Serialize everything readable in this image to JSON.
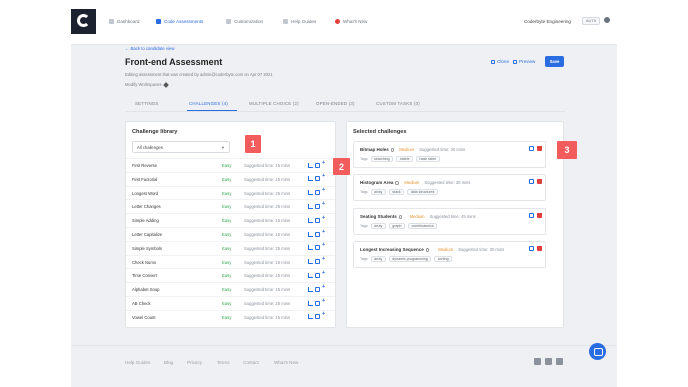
{
  "nav": {
    "items": [
      {
        "label": "Dashboard",
        "active": false
      },
      {
        "label": "Code Assessments",
        "active": true
      },
      {
        "label": "Customization",
        "active": false
      },
      {
        "label": "Help Guides",
        "active": false
      },
      {
        "label": "What's New",
        "active": false
      }
    ],
    "org_name": "Coderbyte Engineering",
    "auto_badge": "AUTH"
  },
  "header": {
    "back_link": "← Back to candidate view",
    "title": "Front-end Assessment",
    "subtitle": "Editing assessment that was created by admin@coderbyte.com on Apr 07 2021",
    "modify": "Modify Workspaces",
    "clone_label": "Clone",
    "preview_label": "Preview",
    "save_label": "Save"
  },
  "tabs": [
    {
      "label": "SETTINGS",
      "active": false
    },
    {
      "label": "CHALLENGES (4)",
      "active": true
    },
    {
      "label": "MULTIPLE CHOICE (2)",
      "active": false
    },
    {
      "label": "OPEN-ENDED (3)",
      "active": false
    },
    {
      "label": "CUSTOM TASKS (0)",
      "active": false
    }
  ],
  "library": {
    "title": "Challenge library",
    "filter_value": "All challenges",
    "challenges": [
      {
        "name": "First Reverse",
        "difficulty": "Easy",
        "time": "Suggested time: 15 mins"
      },
      {
        "name": "First Factorial",
        "difficulty": "Easy",
        "time": "Suggested time: 15 mins"
      },
      {
        "name": "Longest Word",
        "difficulty": "Easy",
        "time": "Suggested time: 25 mins"
      },
      {
        "name": "Letter Changes",
        "difficulty": "Easy",
        "time": "Suggested time: 25 mins"
      },
      {
        "name": "Simple Adding",
        "difficulty": "Easy",
        "time": "Suggested time: 15 mins"
      },
      {
        "name": "Letter Capitalize",
        "difficulty": "Easy",
        "time": "Suggested time: 15 mins"
      },
      {
        "name": "Simple Symbols",
        "difficulty": "Easy",
        "time": "Suggested time: 25 mins"
      },
      {
        "name": "Check Nums",
        "difficulty": "Easy",
        "time": "Suggested time: 15 mins"
      },
      {
        "name": "Time Convert",
        "difficulty": "Easy",
        "time": "Suggested time: 15 mins"
      },
      {
        "name": "Alphabet Soup",
        "difficulty": "Easy",
        "time": "Suggested time: 15 mins"
      },
      {
        "name": "AB Check",
        "difficulty": "Easy",
        "time": "Suggested time: 25 mins"
      },
      {
        "name": "Vowel Count",
        "difficulty": "Easy",
        "time": "Suggested time: 15 mins"
      }
    ]
  },
  "selected": {
    "title": "Selected challenges",
    "items": [
      {
        "name": "Bitmap Holes",
        "difficulty": "Medium",
        "time": "Suggested time: 30 mins",
        "tags_label": "Tags",
        "tags": [
          "searching",
          "matrix",
          "hash table"
        ]
      },
      {
        "name": "Histogram Area",
        "difficulty": "Medium",
        "time": "Suggested time: 30 mins",
        "tags_label": "Tags",
        "tags": [
          "array",
          "stack",
          "data structures"
        ]
      },
      {
        "name": "Seating Students",
        "difficulty": "Medium",
        "time": "Suggested time: 45 mins",
        "tags_label": "Tags",
        "tags": [
          "array",
          "graph",
          "combinatorics"
        ]
      },
      {
        "name": "Longest Increasing Sequence",
        "difficulty": "Medium",
        "time": "Suggested time: 30 mins",
        "tags_label": "Tags",
        "tags": [
          "array",
          "dynamic programming",
          "sorting"
        ]
      }
    ]
  },
  "markers": [
    "1",
    "2",
    "3"
  ],
  "footer": {
    "links": [
      "Help Guides",
      "Blog",
      "Privacy",
      "Terms",
      "Contact",
      "What's New"
    ],
    "social_icons": [
      "facebook-icon",
      "twitter-icon",
      "linkedin-icon"
    ]
  },
  "colors": {
    "accent": "#2a6de3",
    "easy": "#35a853",
    "medium": "#e8932b",
    "marker": "#f25c5c",
    "delete": "#e0403a"
  }
}
